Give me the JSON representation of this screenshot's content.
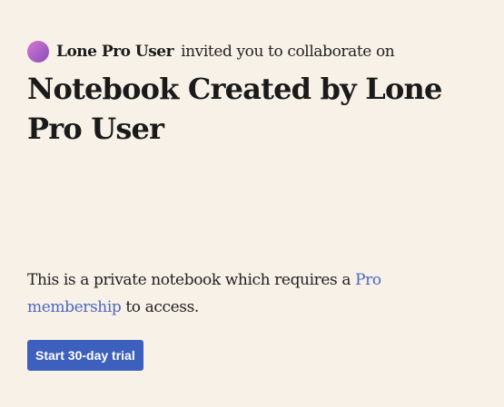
{
  "invite": {
    "avatar_icon": "user-avatar-gradient-circle",
    "user_name": "Lone Pro User",
    "message": "invited you to collaborate on"
  },
  "notebook": {
    "title": "Notebook Created by Lone Pro User"
  },
  "notice": {
    "prefix": "This is a private notebook which requires a ",
    "link_text": "Pro membership",
    "suffix": " to access."
  },
  "cta": {
    "label": "Start 30-day trial"
  },
  "colors": {
    "background": "#f8f1e8",
    "link": "#4a67c4",
    "button": "#3d5fbd"
  }
}
